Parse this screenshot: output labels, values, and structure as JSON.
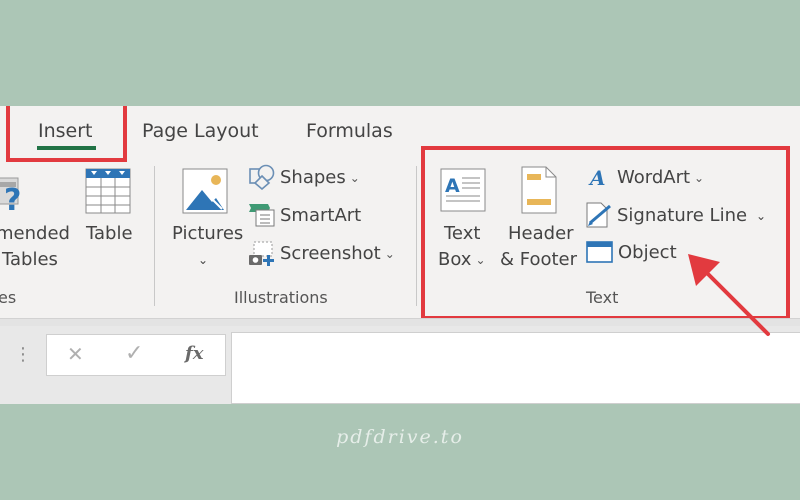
{
  "ribbon": {
    "tabs": [
      {
        "label": "Insert",
        "active": true
      },
      {
        "label": "Page Layout",
        "active": false
      },
      {
        "label": "Formulas",
        "active": false
      }
    ],
    "tables_group": {
      "label_partial": "es",
      "recommended": {
        "line1": "mended",
        "line2": "Tables"
      },
      "table": {
        "label": "Table"
      }
    },
    "illustrations_group": {
      "label": "Illustrations",
      "pictures": {
        "label": "Pictures",
        "chevron": "⌄"
      },
      "shapes": {
        "label": "Shapes",
        "chevron": "⌄"
      },
      "smartart": {
        "label": "SmartArt"
      },
      "screenshot": {
        "label": "Screenshot",
        "chevron": "⌄"
      }
    },
    "text_group": {
      "label": "Text",
      "text_box": {
        "line1": "Text",
        "line2": "Box",
        "chevron": "⌄"
      },
      "header_footer": {
        "line1": "Header",
        "line2": "& Footer"
      },
      "wordart": {
        "label": "WordArt",
        "chevron": "⌄"
      },
      "signature_line": {
        "label": "Signature Line",
        "chevron": "⌄"
      },
      "object": {
        "label": "Object"
      }
    }
  },
  "formula_bar": {
    "cancel_symbol": "✕",
    "enter_symbol": "✓",
    "fx_symbol": "fx",
    "grip_symbol": "⋮",
    "value": ""
  },
  "annotations": {
    "highlight_color": "#e23a3f",
    "accent_underline_color": "#217346"
  },
  "watermark": {
    "text": "pdfdrive.to"
  }
}
